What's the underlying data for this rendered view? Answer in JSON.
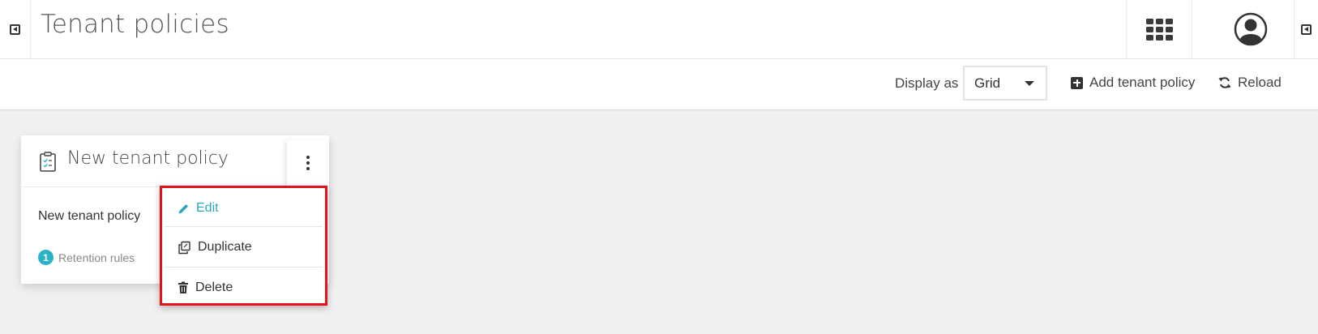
{
  "header": {
    "title": "Tenant policies",
    "collapse_left_icon": "collapse-left-icon",
    "apps_icon": "apps-grid-icon",
    "user_icon": "user-avatar-icon",
    "collapse_right_icon": "collapse-right-icon"
  },
  "toolbar": {
    "display_as_label": "Display as",
    "display_as_value": "Grid",
    "add_label": "Add tenant policy",
    "reload_label": "Reload"
  },
  "card": {
    "title": "New tenant policy",
    "description": "New tenant policy",
    "retention_count": "1",
    "retention_label": "Retention rules",
    "icon": "clipboard-icon"
  },
  "menu": {
    "items": [
      {
        "label": "Edit",
        "icon": "pencil-icon",
        "active": true
      },
      {
        "label": "Duplicate",
        "icon": "duplicate-icon",
        "active": false
      },
      {
        "label": "Delete",
        "icon": "trash-icon",
        "active": false
      }
    ]
  },
  "colors": {
    "accent": "#2ab3c6",
    "highlight_border": "#e3131c",
    "background": "#f0f0f0"
  }
}
